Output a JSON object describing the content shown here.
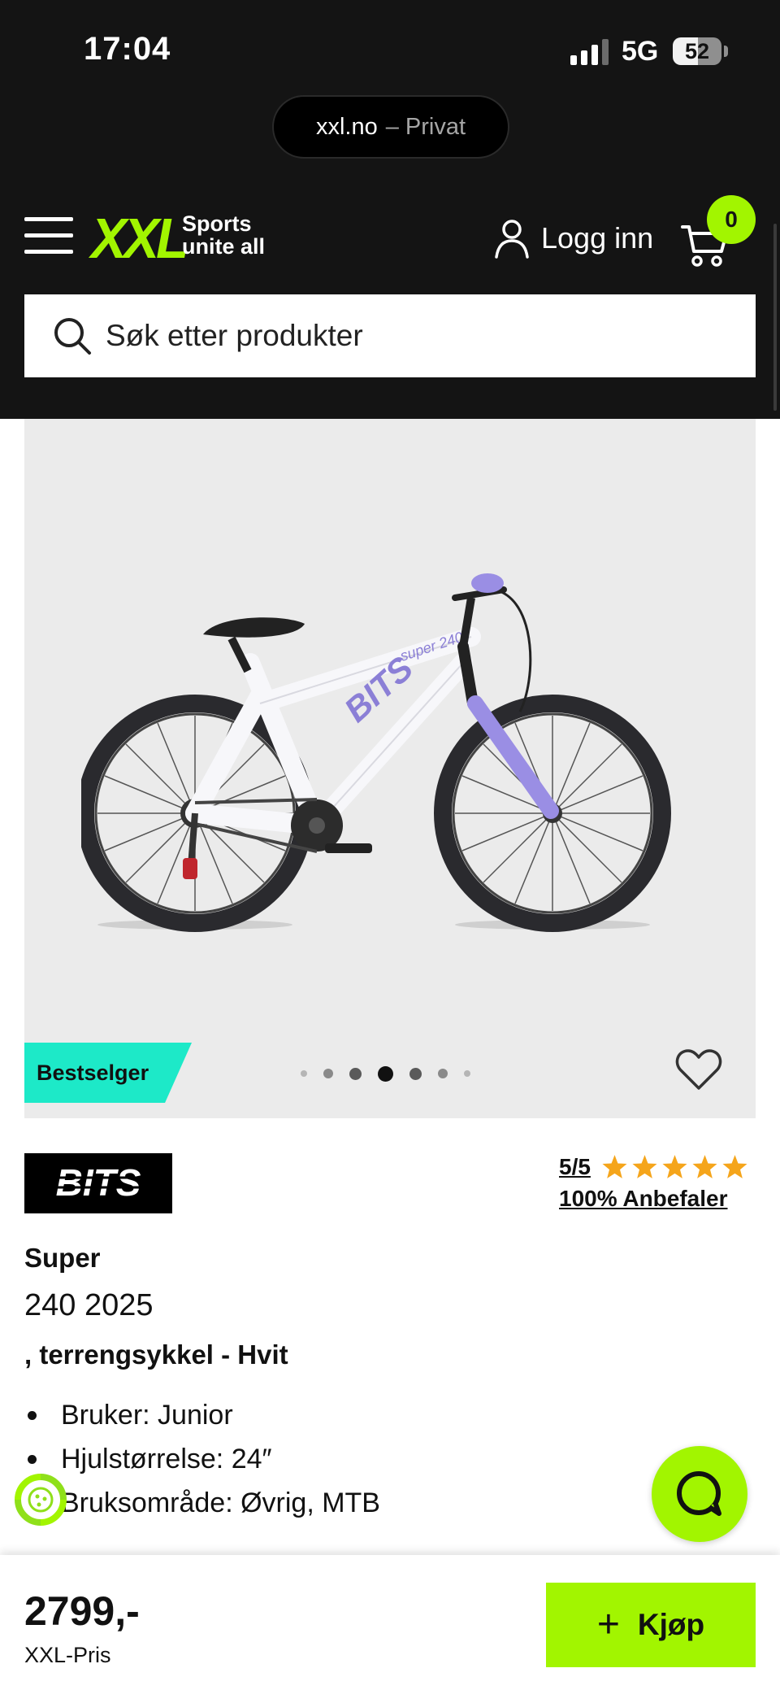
{
  "status_bar": {
    "time": "17:04",
    "network": "5G",
    "battery": "52"
  },
  "browser": {
    "domain": "xxl.no",
    "mode": "– Privat"
  },
  "header": {
    "logo_text": "XXL",
    "logo_tagline_line1": "Sports",
    "logo_tagline_line2": "unite all",
    "login_label": "Logg inn",
    "cart_count": "0",
    "search_placeholder": "Søk etter produkter",
    "accent_color": "#a2f500",
    "background_color": "#141414",
    "icons": [
      "menu-icon",
      "user-icon",
      "cart-icon",
      "search-icon"
    ]
  },
  "gallery": {
    "badge": "Bestselger",
    "badge_color": "#1de9c8",
    "image_count": 7,
    "active_index": 3,
    "icons": [
      "heart-icon"
    ]
  },
  "product": {
    "brand": "BITS",
    "rating": "5/5",
    "stars": 5,
    "recommend": "100% Anbefaler",
    "title_line1": "Super",
    "title_line2": "240 2025",
    "title_line3": ", terrengsykkel - Hvit",
    "specs": [
      "Bruker: Junior",
      "Hjulstørrelse: 24″",
      "Bruksområde: Øvrig, MTB"
    ]
  },
  "buy_bar": {
    "price": "2799,-",
    "price_label": "XXL-Pris",
    "buy_label": "Kjøp",
    "buy_icon": "+"
  }
}
